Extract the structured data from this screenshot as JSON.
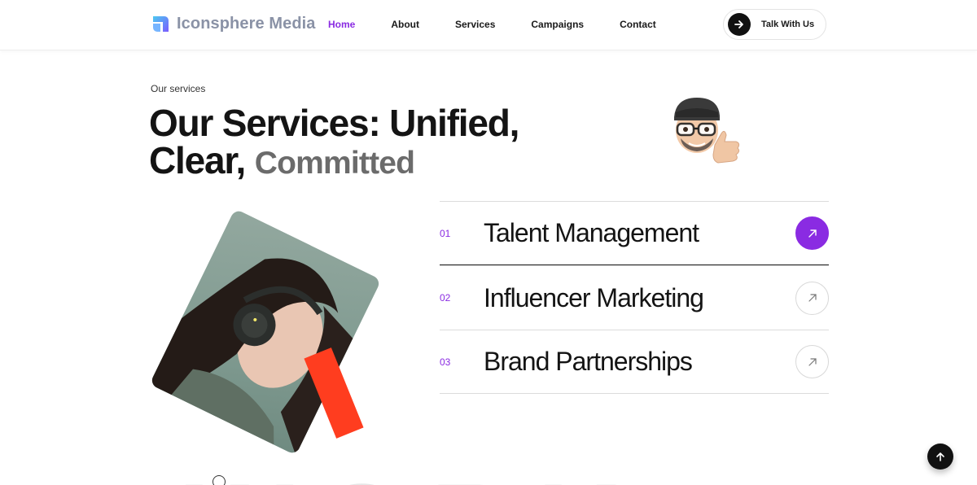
{
  "brand": {
    "name": "Iconsphere Media",
    "accent": "#8a2be2",
    "logo_icon": "iconsphere-logo-icon"
  },
  "nav": {
    "items": [
      {
        "label": "Home",
        "active": true
      },
      {
        "label": "About",
        "active": false
      },
      {
        "label": "Services",
        "active": false
      },
      {
        "label": "Campaigns",
        "active": false
      },
      {
        "label": "Contact",
        "active": false
      }
    ],
    "cta_label": "Talk With Us",
    "cta_icon": "arrow-right-icon"
  },
  "hero": {
    "eyebrow": "Our services",
    "headline_line1": "Our Services: Unified,",
    "headline_line2_main": "Clear,",
    "headline_line2_muted": "Committed"
  },
  "services": [
    {
      "number": "01",
      "title": "Talent Management",
      "active": true,
      "icon": "arrow-up-right-icon"
    },
    {
      "number": "02",
      "title": "Influencer Marketing",
      "active": false,
      "icon": "arrow-up-right-icon"
    },
    {
      "number": "03",
      "title": "Brand Partnerships",
      "active": false,
      "icon": "arrow-up-right-icon"
    }
  ],
  "watermark": "WORK",
  "colors": {
    "accent": "#8a2be2",
    "tag_red": "#ff3d1f",
    "dark": "#111111"
  },
  "back_to_top_icon": "arrow-up-icon"
}
